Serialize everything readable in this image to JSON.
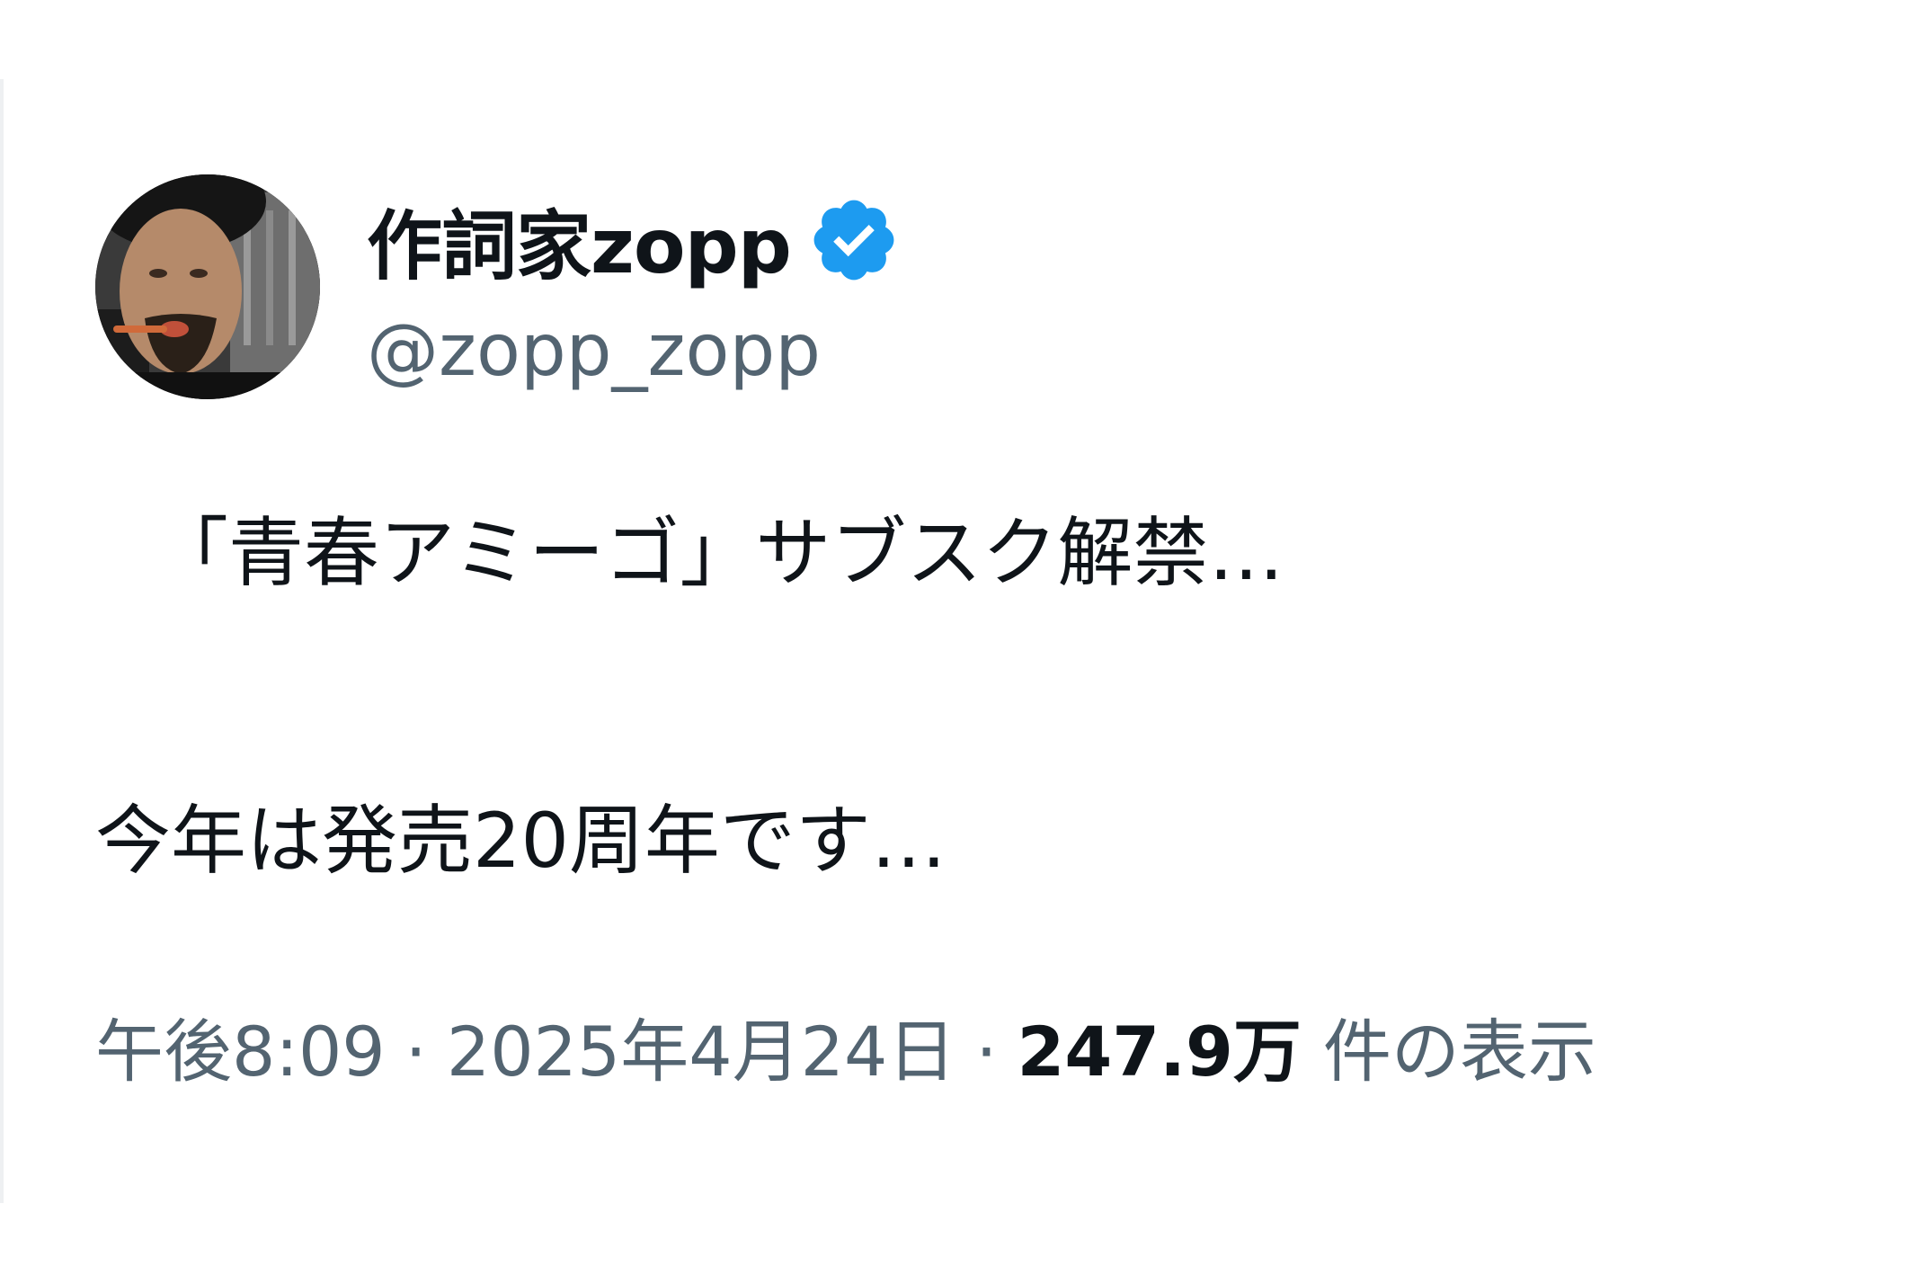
{
  "author": {
    "display_name": "作詞家zopp",
    "handle": "@zopp_zopp",
    "verified": true
  },
  "tweet": {
    "lines": [
      "「青春アミーゴ」サブスク解禁…",
      "今年は発売20周年です…"
    ]
  },
  "meta": {
    "time": "午後8:09",
    "separator": "·",
    "date": "2025年4月24日",
    "views_count": "247.9万",
    "views_label": "件の表示"
  },
  "colors": {
    "text_primary": "#0f1419",
    "text_secondary": "#536471",
    "verified_badge": "#1d9bf0"
  },
  "icons": {
    "verified": "verified-badge-icon",
    "avatar": "profile-photo"
  }
}
